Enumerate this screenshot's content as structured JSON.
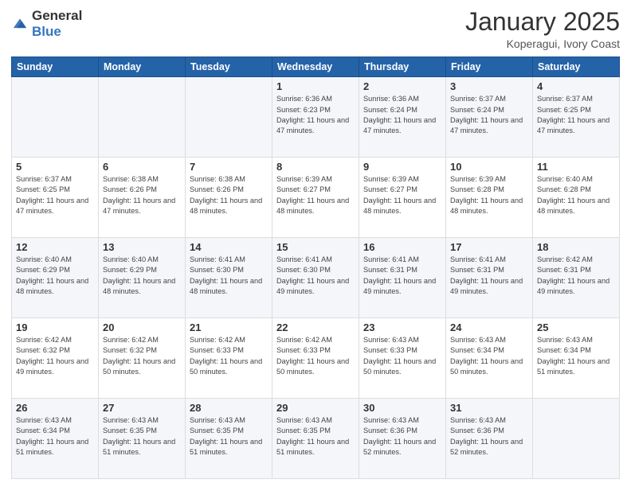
{
  "header": {
    "logo_general": "General",
    "logo_blue": "Blue",
    "title": "January 2025",
    "subtitle": "Koperagui, Ivory Coast"
  },
  "weekdays": [
    "Sunday",
    "Monday",
    "Tuesday",
    "Wednesday",
    "Thursday",
    "Friday",
    "Saturday"
  ],
  "weeks": [
    {
      "days": [
        {
          "num": "",
          "sunrise": "",
          "sunset": "",
          "daylight": "",
          "empty": true
        },
        {
          "num": "",
          "sunrise": "",
          "sunset": "",
          "daylight": "",
          "empty": true
        },
        {
          "num": "",
          "sunrise": "",
          "sunset": "",
          "daylight": "",
          "empty": true
        },
        {
          "num": "1",
          "sunrise": "Sunrise: 6:36 AM",
          "sunset": "Sunset: 6:23 PM",
          "daylight": "Daylight: 11 hours and 47 minutes."
        },
        {
          "num": "2",
          "sunrise": "Sunrise: 6:36 AM",
          "sunset": "Sunset: 6:24 PM",
          "daylight": "Daylight: 11 hours and 47 minutes."
        },
        {
          "num": "3",
          "sunrise": "Sunrise: 6:37 AM",
          "sunset": "Sunset: 6:24 PM",
          "daylight": "Daylight: 11 hours and 47 minutes."
        },
        {
          "num": "4",
          "sunrise": "Sunrise: 6:37 AM",
          "sunset": "Sunset: 6:25 PM",
          "daylight": "Daylight: 11 hours and 47 minutes."
        }
      ]
    },
    {
      "days": [
        {
          "num": "5",
          "sunrise": "Sunrise: 6:37 AM",
          "sunset": "Sunset: 6:25 PM",
          "daylight": "Daylight: 11 hours and 47 minutes."
        },
        {
          "num": "6",
          "sunrise": "Sunrise: 6:38 AM",
          "sunset": "Sunset: 6:26 PM",
          "daylight": "Daylight: 11 hours and 47 minutes."
        },
        {
          "num": "7",
          "sunrise": "Sunrise: 6:38 AM",
          "sunset": "Sunset: 6:26 PM",
          "daylight": "Daylight: 11 hours and 48 minutes."
        },
        {
          "num": "8",
          "sunrise": "Sunrise: 6:39 AM",
          "sunset": "Sunset: 6:27 PM",
          "daylight": "Daylight: 11 hours and 48 minutes."
        },
        {
          "num": "9",
          "sunrise": "Sunrise: 6:39 AM",
          "sunset": "Sunset: 6:27 PM",
          "daylight": "Daylight: 11 hours and 48 minutes."
        },
        {
          "num": "10",
          "sunrise": "Sunrise: 6:39 AM",
          "sunset": "Sunset: 6:28 PM",
          "daylight": "Daylight: 11 hours and 48 minutes."
        },
        {
          "num": "11",
          "sunrise": "Sunrise: 6:40 AM",
          "sunset": "Sunset: 6:28 PM",
          "daylight": "Daylight: 11 hours and 48 minutes."
        }
      ]
    },
    {
      "days": [
        {
          "num": "12",
          "sunrise": "Sunrise: 6:40 AM",
          "sunset": "Sunset: 6:29 PM",
          "daylight": "Daylight: 11 hours and 48 minutes."
        },
        {
          "num": "13",
          "sunrise": "Sunrise: 6:40 AM",
          "sunset": "Sunset: 6:29 PM",
          "daylight": "Daylight: 11 hours and 48 minutes."
        },
        {
          "num": "14",
          "sunrise": "Sunrise: 6:41 AM",
          "sunset": "Sunset: 6:30 PM",
          "daylight": "Daylight: 11 hours and 48 minutes."
        },
        {
          "num": "15",
          "sunrise": "Sunrise: 6:41 AM",
          "sunset": "Sunset: 6:30 PM",
          "daylight": "Daylight: 11 hours and 49 minutes."
        },
        {
          "num": "16",
          "sunrise": "Sunrise: 6:41 AM",
          "sunset": "Sunset: 6:31 PM",
          "daylight": "Daylight: 11 hours and 49 minutes."
        },
        {
          "num": "17",
          "sunrise": "Sunrise: 6:41 AM",
          "sunset": "Sunset: 6:31 PM",
          "daylight": "Daylight: 11 hours and 49 minutes."
        },
        {
          "num": "18",
          "sunrise": "Sunrise: 6:42 AM",
          "sunset": "Sunset: 6:31 PM",
          "daylight": "Daylight: 11 hours and 49 minutes."
        }
      ]
    },
    {
      "days": [
        {
          "num": "19",
          "sunrise": "Sunrise: 6:42 AM",
          "sunset": "Sunset: 6:32 PM",
          "daylight": "Daylight: 11 hours and 49 minutes."
        },
        {
          "num": "20",
          "sunrise": "Sunrise: 6:42 AM",
          "sunset": "Sunset: 6:32 PM",
          "daylight": "Daylight: 11 hours and 50 minutes."
        },
        {
          "num": "21",
          "sunrise": "Sunrise: 6:42 AM",
          "sunset": "Sunset: 6:33 PM",
          "daylight": "Daylight: 11 hours and 50 minutes."
        },
        {
          "num": "22",
          "sunrise": "Sunrise: 6:42 AM",
          "sunset": "Sunset: 6:33 PM",
          "daylight": "Daylight: 11 hours and 50 minutes."
        },
        {
          "num": "23",
          "sunrise": "Sunrise: 6:43 AM",
          "sunset": "Sunset: 6:33 PM",
          "daylight": "Daylight: 11 hours and 50 minutes."
        },
        {
          "num": "24",
          "sunrise": "Sunrise: 6:43 AM",
          "sunset": "Sunset: 6:34 PM",
          "daylight": "Daylight: 11 hours and 50 minutes."
        },
        {
          "num": "25",
          "sunrise": "Sunrise: 6:43 AM",
          "sunset": "Sunset: 6:34 PM",
          "daylight": "Daylight: 11 hours and 51 minutes."
        }
      ]
    },
    {
      "days": [
        {
          "num": "26",
          "sunrise": "Sunrise: 6:43 AM",
          "sunset": "Sunset: 6:34 PM",
          "daylight": "Daylight: 11 hours and 51 minutes."
        },
        {
          "num": "27",
          "sunrise": "Sunrise: 6:43 AM",
          "sunset": "Sunset: 6:35 PM",
          "daylight": "Daylight: 11 hours and 51 minutes."
        },
        {
          "num": "28",
          "sunrise": "Sunrise: 6:43 AM",
          "sunset": "Sunset: 6:35 PM",
          "daylight": "Daylight: 11 hours and 51 minutes."
        },
        {
          "num": "29",
          "sunrise": "Sunrise: 6:43 AM",
          "sunset": "Sunset: 6:35 PM",
          "daylight": "Daylight: 11 hours and 51 minutes."
        },
        {
          "num": "30",
          "sunrise": "Sunrise: 6:43 AM",
          "sunset": "Sunset: 6:36 PM",
          "daylight": "Daylight: 11 hours and 52 minutes."
        },
        {
          "num": "31",
          "sunrise": "Sunrise: 6:43 AM",
          "sunset": "Sunset: 6:36 PM",
          "daylight": "Daylight: 11 hours and 52 minutes."
        },
        {
          "num": "",
          "sunrise": "",
          "sunset": "",
          "daylight": "",
          "empty": true
        }
      ]
    }
  ]
}
